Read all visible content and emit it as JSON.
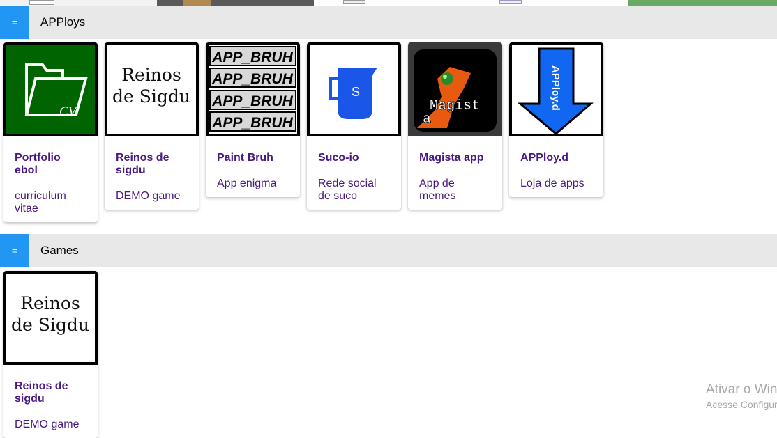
{
  "sections": [
    {
      "menu_icon": "=",
      "title": "APPloys",
      "cards": [
        {
          "title": "Portfolio ebol",
          "desc": "curriculum vitae",
          "icon": "folder-cv-icon",
          "thumb_text": "CV"
        },
        {
          "title": "Reinos de sigdu",
          "desc": "DEMO game",
          "icon": "reinos-de-sigdu-logo",
          "thumb_lines": [
            "Reinos",
            "de Sigdu"
          ]
        },
        {
          "title": "Paint Bruh",
          "desc": "App enigma",
          "icon": "app-bruh-logo",
          "thumb_lines": [
            "APP_BRUH",
            "APP_BRUH",
            "APP_BRUH",
            "APP_BRUH"
          ]
        },
        {
          "title": "Suco-io",
          "desc": "Rede social de suco",
          "icon": "juice-cup-icon",
          "thumb_text": "S"
        },
        {
          "title": "Magista app",
          "desc": "App de memes",
          "icon": "magista-logo",
          "thumb_lines": [
            "Magist",
            "a"
          ]
        },
        {
          "title": "APPloy.d",
          "desc": "Loja de apps",
          "icon": "download-arrow-icon",
          "thumb_text": "APPloy.d"
        }
      ]
    },
    {
      "menu_icon": "=",
      "title": "Games",
      "cards": [
        {
          "title": "Reinos de sigdu",
          "desc": "DEMO game",
          "icon": "reinos-de-sigdu-logo",
          "thumb_lines": [
            "Reinos",
            "de Sigdu"
          ]
        }
      ]
    }
  ],
  "watermark": {
    "line1": "Ativar o Windows",
    "line2": "Acesse Configurações"
  },
  "colors": {
    "menu_button": "#2196f3",
    "section_bar": "#e8e8e8",
    "card_text": "#4a1a83",
    "cv_green": "#006400",
    "suco_blue": "#1a56e8",
    "ploy_blue": "#1167f2",
    "magista_orange": "#e85a10"
  }
}
